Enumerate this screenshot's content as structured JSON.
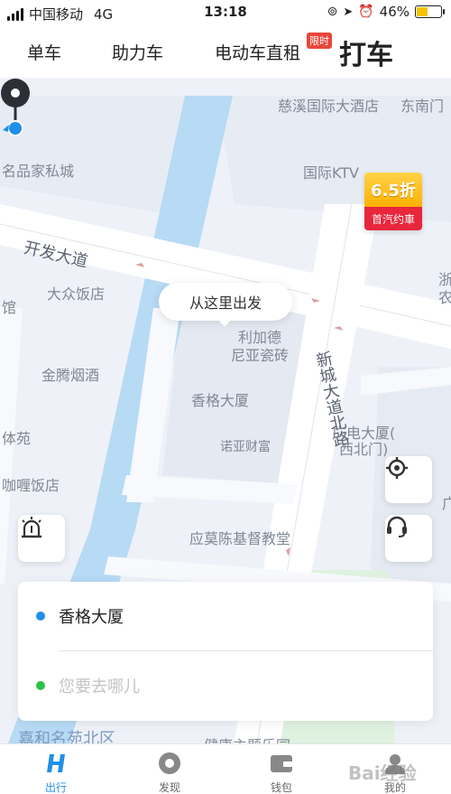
{
  "status_bar": {
    "carrier": "中国移动",
    "network": "4G",
    "time": "13:18",
    "battery": "46%",
    "battery_level": 0.46
  },
  "top_tabs": [
    {
      "label": "单车"
    },
    {
      "label": "助力车"
    },
    {
      "label": "电动车直租"
    },
    {
      "label": "打车"
    }
  ],
  "limited_badge": "限时",
  "map": {
    "labels": [
      "慈溪国际大酒店",
      "东南门",
      "名品家私城",
      "国际KTV",
      "开发大道",
      "大众饭店",
      "馆",
      "金腾烟酒",
      "利加德",
      "尼亚瓷砖",
      "香格大厦",
      "新城大道北路",
      "体苑",
      "诺亚财富",
      "广电大厦(",
      "西北门)",
      "咖喱饭店",
      "应莫陈基督教堂",
      "嘉和名苑北区",
      "健康主题乐园",
      "浙",
      "农",
      "广"
    ],
    "promo": {
      "discount": "6.5折",
      "text": "首汽约車"
    },
    "tooltip": "从这里出发"
  },
  "route": {
    "origin": "香格大厦",
    "destination_placeholder": "您要去哪儿",
    "origin_color": "#1f8fe8",
    "destination_color": "#2bc24a"
  },
  "bottom_nav": [
    {
      "label": "出行",
      "icon": "ride-icon",
      "active": true
    },
    {
      "label": "发现",
      "icon": "discover-icon",
      "active": false
    },
    {
      "label": "钱包",
      "icon": "wallet-icon",
      "active": false
    },
    {
      "label": "我的",
      "icon": "profile-icon",
      "active": false
    }
  ],
  "watermark": "Bai经验"
}
